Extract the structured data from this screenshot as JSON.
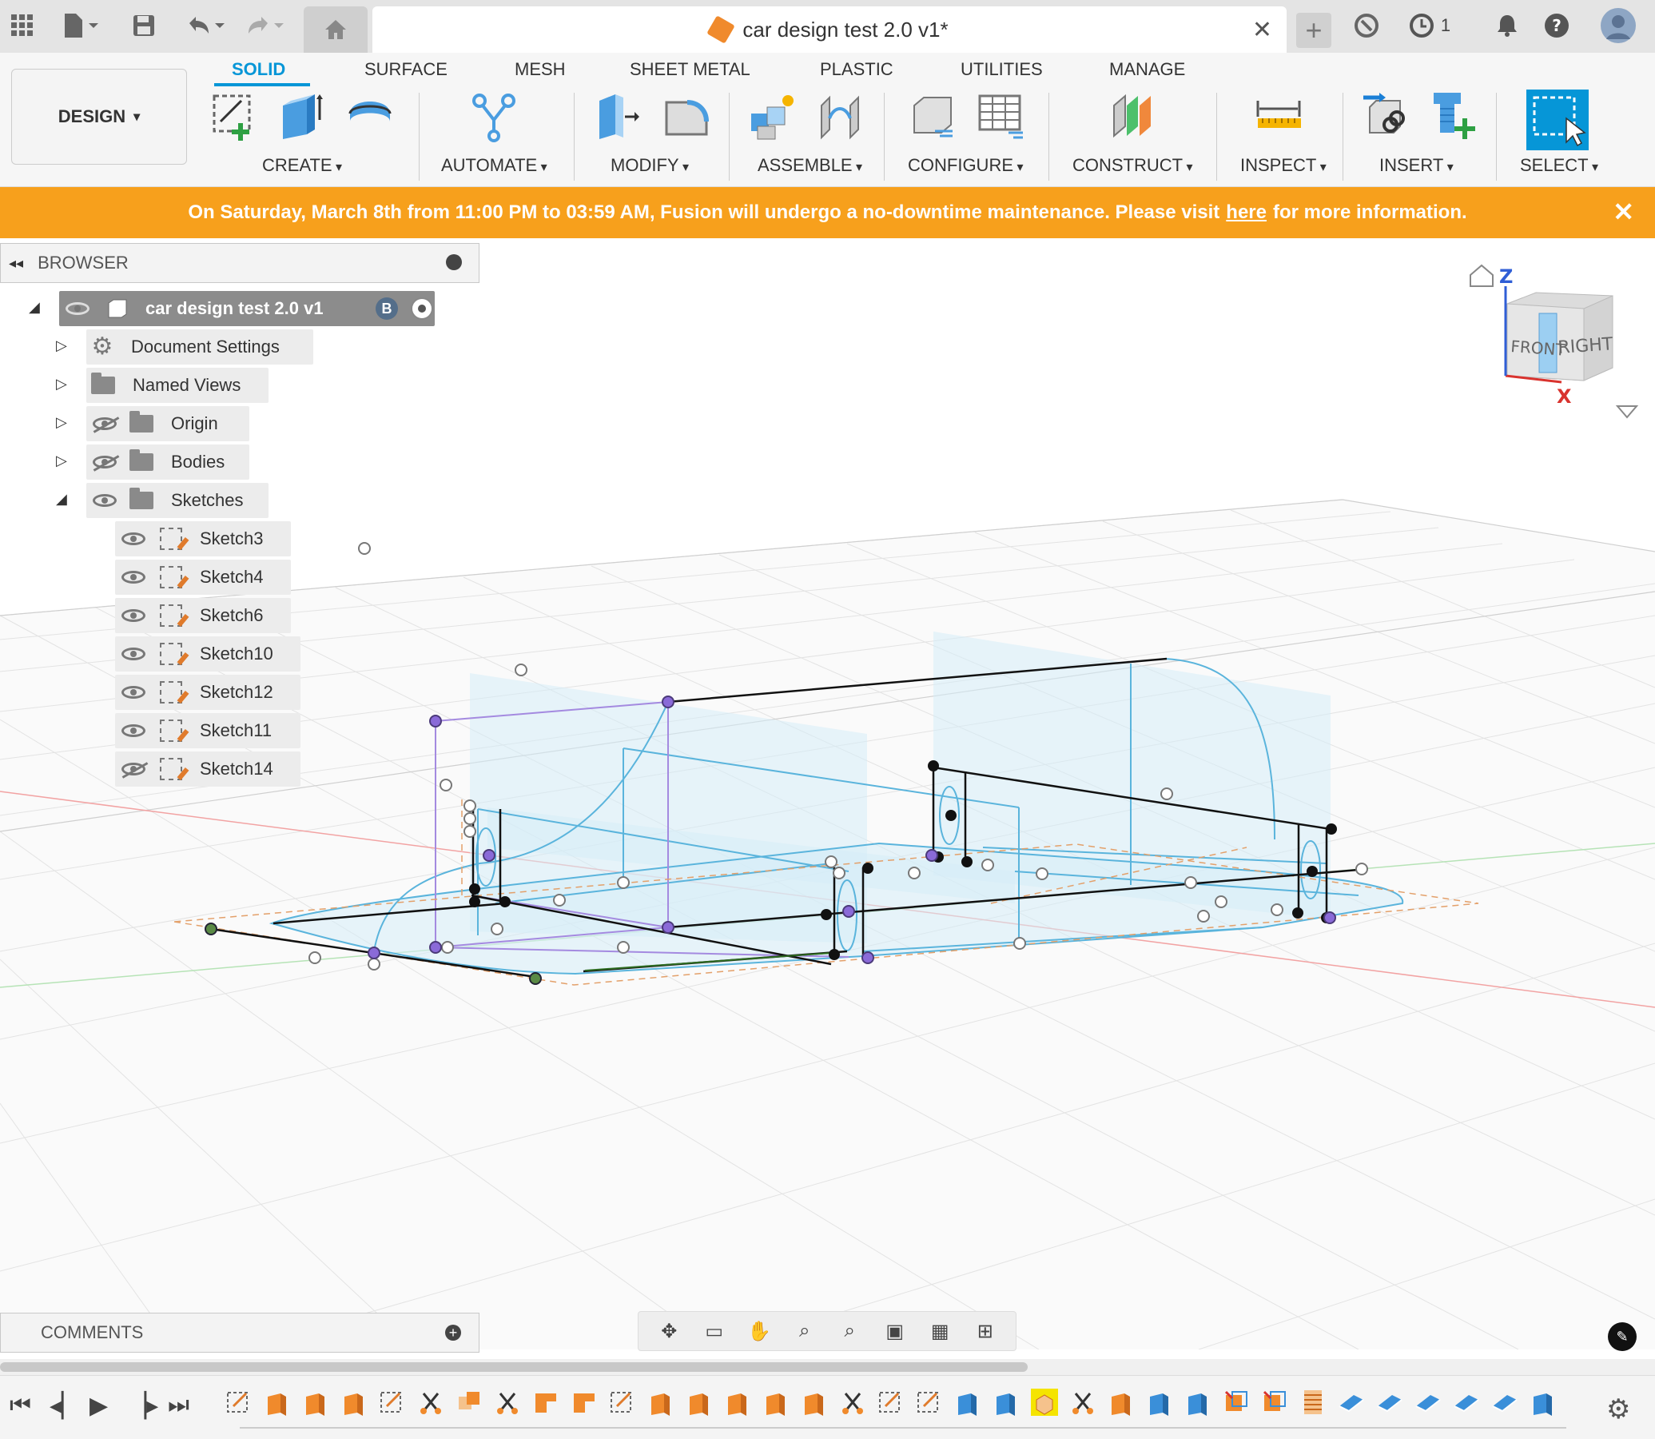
{
  "window": {
    "doc_title": "car design test 2.0 v1*",
    "jobs_count": "1"
  },
  "ribbon": {
    "workspace": "DESIGN",
    "tabs": [
      "SOLID",
      "SURFACE",
      "MESH",
      "SHEET METAL",
      "PLASTIC",
      "UTILITIES",
      "MANAGE"
    ],
    "groups": [
      "CREATE",
      "AUTOMATE",
      "MODIFY",
      "ASSEMBLE",
      "CONFIGURE",
      "CONSTRUCT",
      "INSPECT",
      "INSERT",
      "SELECT"
    ]
  },
  "banner": {
    "text_before": "On Saturday, March 8th from 11:00 PM to 03:59 AM, Fusion will undergo a no-downtime maintenance. Please visit",
    "link": "here",
    "text_after": "for more information."
  },
  "browser": {
    "title": "BROWSER",
    "root": "car design test 2.0 v1",
    "root_badge": "B",
    "items": [
      {
        "label": "Document Settings",
        "icon": "gear-icon"
      },
      {
        "label": "Named Views",
        "icon": "folder-icon"
      },
      {
        "label": "Origin",
        "icon": "folder-icon",
        "visible": false
      },
      {
        "label": "Bodies",
        "icon": "folder-icon",
        "visible": false
      },
      {
        "label": "Sketches",
        "icon": "folder-icon",
        "visible": true,
        "expanded": true
      }
    ],
    "sketches": [
      {
        "label": "Sketch3",
        "visible": true
      },
      {
        "label": "Sketch4",
        "visible": true
      },
      {
        "label": "Sketch6",
        "visible": true
      },
      {
        "label": "Sketch10",
        "visible": true
      },
      {
        "label": "Sketch12",
        "visible": true
      },
      {
        "label": "Sketch11",
        "visible": true
      },
      {
        "label": "Sketch14",
        "visible": false
      }
    ]
  },
  "viewcube": {
    "front": "FRONT",
    "right": "RIGHT",
    "z_axis": "Z",
    "x_axis": "X"
  },
  "comments": {
    "title": "COMMENTS"
  },
  "colors": {
    "accent": "#0696d7",
    "banner": "#f7a01c",
    "sketch_blue": "#5ab4dc",
    "sketch_fill": "#d6ecf8",
    "timeline_orange": "#f08a2c",
    "timeline_blue": "#3a8fd9"
  }
}
